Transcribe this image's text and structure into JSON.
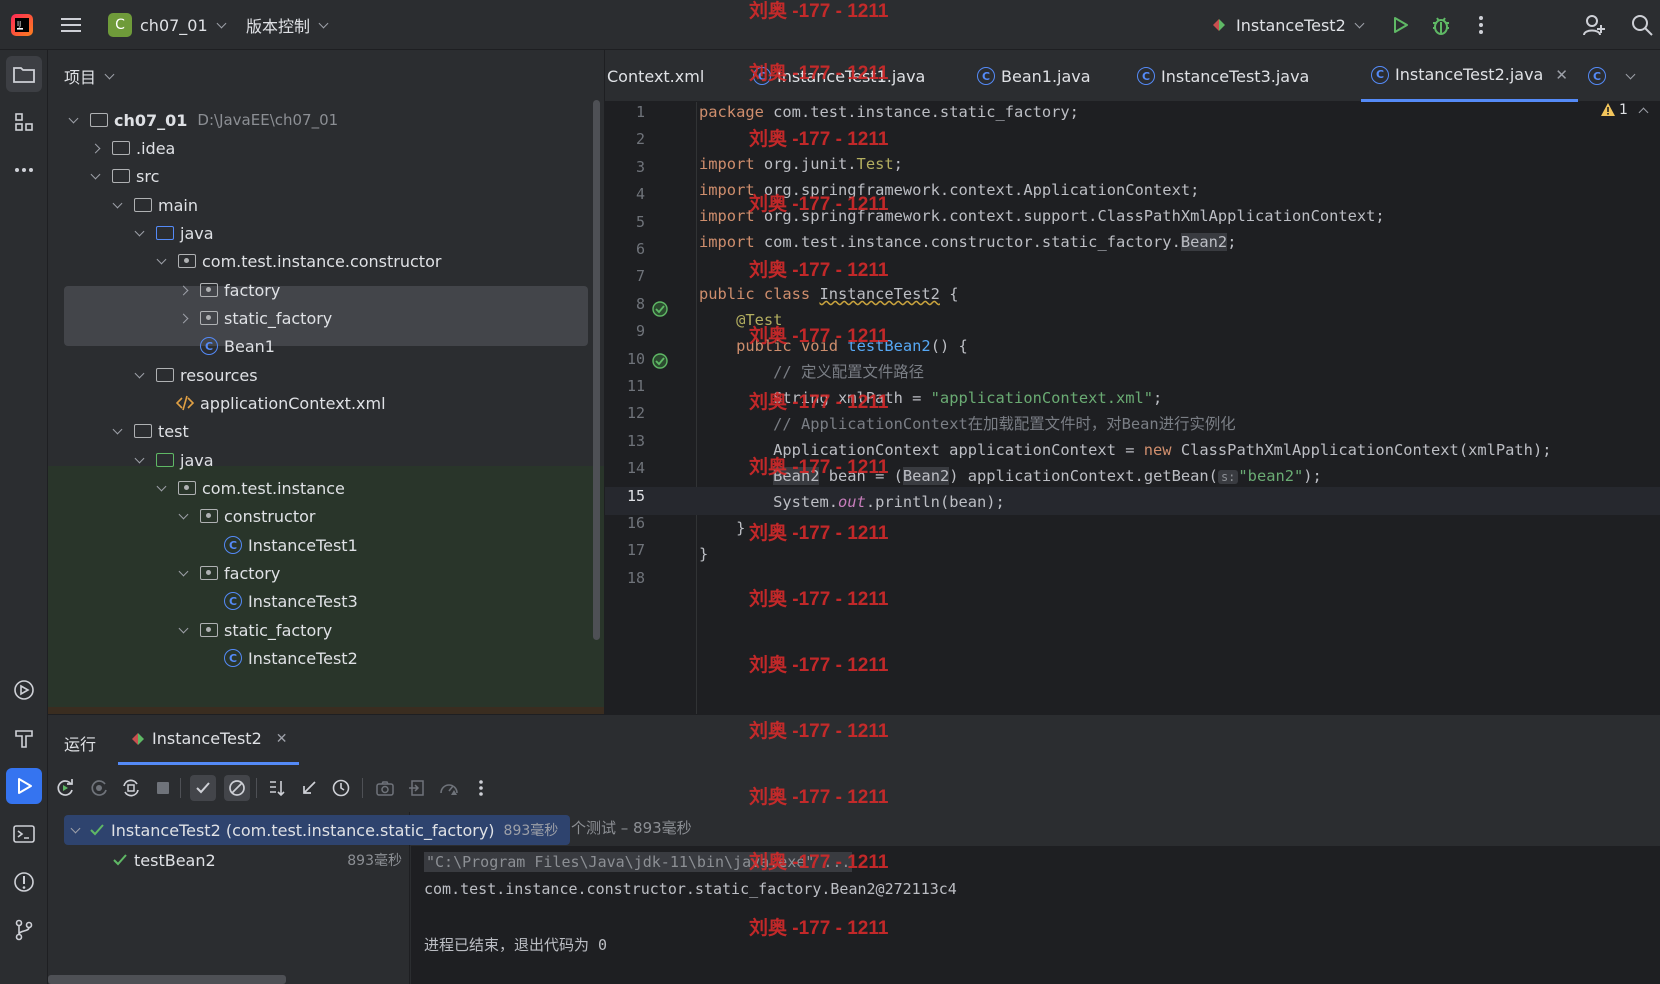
{
  "titlebar": {
    "project_initial": "C",
    "project_name": "ch07_01",
    "vcs_label": "版本控制",
    "run_config": "InstanceTest2"
  },
  "project_panel": {
    "title": "项目",
    "tree": [
      {
        "label": "ch07_01",
        "path": "D:\\JavaEE\\ch07_01"
      },
      {
        "label": ".idea"
      },
      {
        "label": "src"
      },
      {
        "label": "main"
      },
      {
        "label": "java"
      },
      {
        "label": "com.test.instance.constructor"
      },
      {
        "label": "factory"
      },
      {
        "label": "static_factory"
      },
      {
        "label": "Bean1"
      },
      {
        "label": "resources"
      },
      {
        "label": "applicationContext.xml"
      },
      {
        "label": "test"
      },
      {
        "label": "java"
      },
      {
        "label": "com.test.instance"
      },
      {
        "label": "constructor"
      },
      {
        "label": "InstanceTest1"
      },
      {
        "label": "factory"
      },
      {
        "label": "InstanceTest3"
      },
      {
        "label": "static_factory"
      },
      {
        "label": "InstanceTest2"
      }
    ]
  },
  "tabs": [
    {
      "label": "Context.xml"
    },
    {
      "label": "InstanceTest1.java"
    },
    {
      "label": "Bean1.java"
    },
    {
      "label": "InstanceTest3.java"
    },
    {
      "label": "InstanceTest2.java"
    }
  ],
  "editor": {
    "warning_count": "1",
    "current_line": "15",
    "line_numbers": [
      "1",
      "2",
      "3",
      "4",
      "5",
      "6",
      "7",
      "8",
      "9",
      "10",
      "11",
      "12",
      "13",
      "14",
      "15",
      "16",
      "17",
      "18"
    ],
    "inlay_hint": "s:"
  },
  "run_panel": {
    "tab_run": "运行",
    "tab_config": "InstanceTest2",
    "suite_label": "InstanceTest2 (com.test.instance.static_factory)",
    "suite_time": "893毫秒",
    "summary": "个测试 – 893毫秒",
    "test_label": "testBean2",
    "test_time": "893毫秒",
    "console": [
      "\"C:\\Program Files\\Java\\jdk-11\\bin\\java.exe\" ...",
      "com.test.instance.constructor.static_factory.Bean2@272113c4",
      "",
      "进程已结束，退出代码为 0"
    ]
  },
  "watermark": "刘奥 -177 - 1211",
  "colors": {
    "accent": "#548af7",
    "keyword": "#cf8e6d",
    "string": "#6aab73",
    "pass": "#5fb865",
    "watermark": "#d42a2a"
  }
}
